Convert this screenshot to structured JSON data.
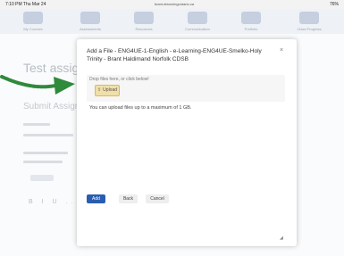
{
  "status_bar": {
    "time": "7:10 PM  Thu Mar 24",
    "url": "brant.elearningontario.ca",
    "battery": "76%"
  },
  "background": {
    "nav": [
      {
        "label": "My Courses"
      },
      {
        "label": "Assessments"
      },
      {
        "label": "Resources"
      },
      {
        "label": "Communication"
      },
      {
        "label": "Portfolio"
      },
      {
        "label": "Class Progress"
      }
    ],
    "title": "Test assignment",
    "subtitle": "Submit Assignment",
    "tools": "B I U ..."
  },
  "modal": {
    "title": "Add a File - ENG4UE-1-English - e-Learning-ENG4UE-Smelko-Holy Trinity - Brant Haldimand Norfolk CDSB",
    "close_label": "×",
    "dropzone": {
      "text": "Drop files here, or click below!",
      "upload_label": "Upload"
    },
    "limit_text": "You can upload files up to a maximum of 1 GB.",
    "buttons": {
      "add": "Add",
      "back": "Back",
      "cancel": "Cancel"
    }
  },
  "colors": {
    "accent": "#2a5db0",
    "upload_button": "#f1dfa8",
    "arrow": "#2f8a3c"
  }
}
